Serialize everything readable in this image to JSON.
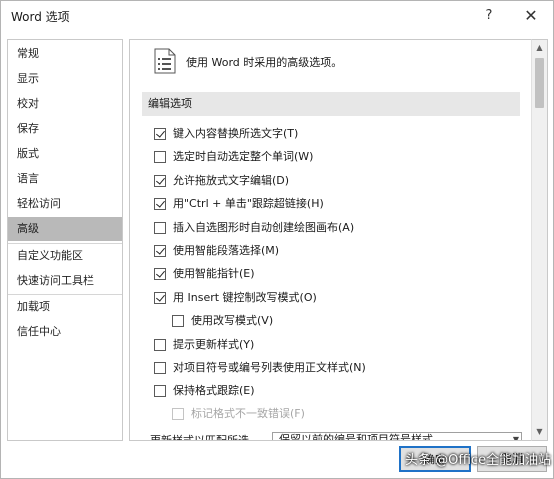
{
  "window": {
    "title": "Word 选项",
    "help_label": "?",
    "close_label": "✕"
  },
  "sidebar": {
    "items": [
      {
        "label": "常规"
      },
      {
        "label": "显示"
      },
      {
        "label": "校对"
      },
      {
        "label": "保存"
      },
      {
        "label": "版式"
      },
      {
        "label": "语言"
      },
      {
        "label": "轻松访问"
      },
      {
        "label": "高级",
        "selected": true
      },
      {
        "label": "自定义功能区"
      },
      {
        "label": "快速访问工具栏"
      },
      {
        "label": "加载项"
      },
      {
        "label": "信任中心"
      }
    ]
  },
  "main": {
    "header": "使用 Word 时采用的高级选项。",
    "section_title": "编辑选项",
    "options": [
      {
        "label": "键入内容替换所选文字(T)",
        "checked": true
      },
      {
        "label": "选定时自动选定整个单词(W)",
        "checked": false
      },
      {
        "label": "允许拖放式文字编辑(D)",
        "checked": true
      },
      {
        "label": "用\"Ctrl + 单击\"跟踪超链接(H)",
        "checked": true
      },
      {
        "label": "插入自选图形时自动创建绘图画布(A)",
        "checked": false
      },
      {
        "label": "使用智能段落选择(M)",
        "checked": true
      },
      {
        "label": "使用智能指针(E)",
        "checked": true
      },
      {
        "label": "用 Insert 键控制改写模式(O)",
        "checked": true
      },
      {
        "label": "使用改写模式(V)",
        "checked": false
      },
      {
        "label": "提示更新样式(Y)",
        "checked": false
      },
      {
        "label": "对项目符号或编号列表使用正文样式(N)",
        "checked": false
      },
      {
        "label": "保持格式跟踪(E)",
        "checked": false
      },
      {
        "label": "标记格式不一致错误(F)",
        "checked": false,
        "disabled": true
      }
    ],
    "bottom_label": "更新样式以匹配所选",
    "bottom_select_value": "保留以前的编号和项目符号样式"
  },
  "footer": {
    "ok_label": "确定",
    "cancel_label": "取消"
  },
  "watermark": "头条 @Office全能加油站",
  "scrollbar": {
    "up_arrow": "▲",
    "down_arrow": "▼"
  }
}
